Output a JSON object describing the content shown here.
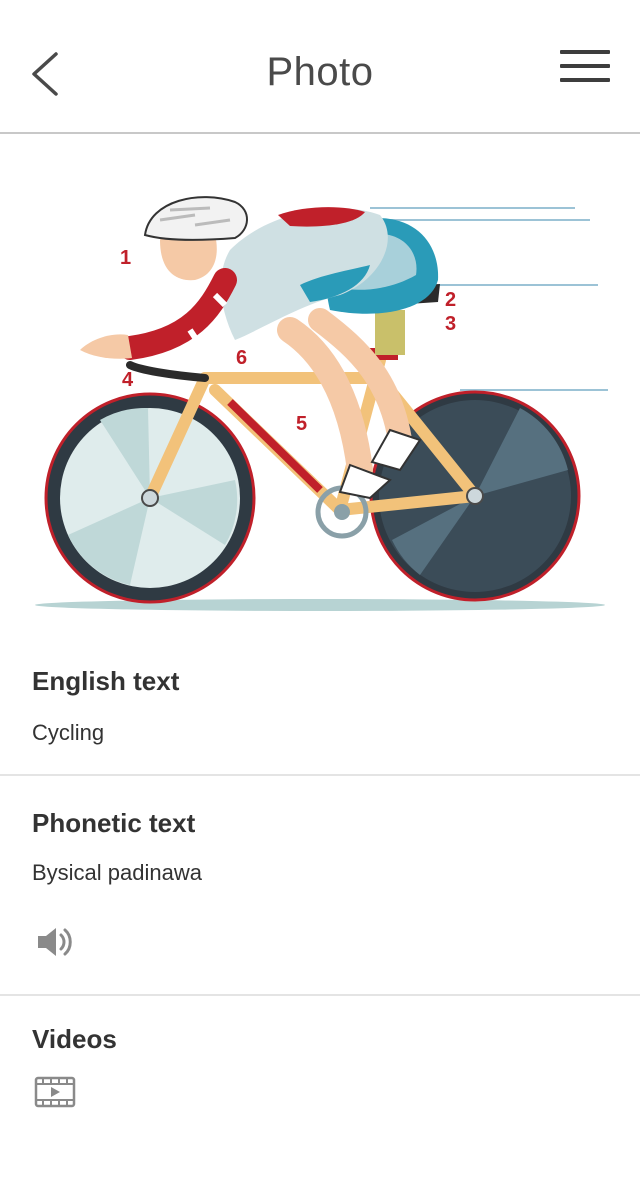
{
  "header": {
    "title": "Photo"
  },
  "illustration": {
    "markers": [
      "1",
      "2",
      "3",
      "4",
      "5",
      "6"
    ]
  },
  "english": {
    "label": "English text",
    "value": "Cycling"
  },
  "phonetic": {
    "label": "Phonetic text",
    "value": "Bysical padinawa"
  },
  "videos": {
    "label": "Videos"
  },
  "icons": {
    "back": "chevron-left-icon",
    "menu": "hamburger-menu-icon",
    "audio": "speaker-icon",
    "video": "film-icon"
  },
  "colors": {
    "header_text": "#4a4a4a",
    "divider": "#e4e4e4",
    "marker_red": "#c0202a"
  }
}
